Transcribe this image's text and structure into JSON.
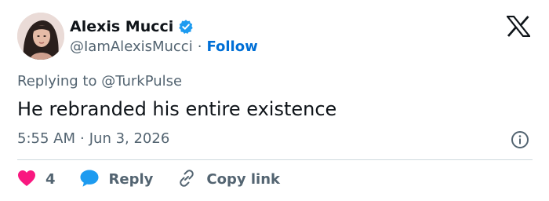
{
  "author": {
    "name": "Alexis Mucci",
    "handle": "@IamAlexisMucci",
    "separator": "·",
    "follow_label": "Follow",
    "verified": true
  },
  "tweet": {
    "replying_to": "Replying to @TurkPulse",
    "text": "He rebranded his entire existence",
    "time": "5:55 AM",
    "time_separator": "·",
    "date": "Jun 3, 2026"
  },
  "actions": {
    "like_count": "4",
    "reply_label": "Reply",
    "copy_link_label": "Copy link"
  },
  "icons": {
    "logo": "x-logo-icon",
    "verified": "verified-badge-icon",
    "info": "info-icon",
    "like": "heart-icon",
    "reply": "speech-bubble-icon",
    "copy": "link-icon"
  },
  "colors": {
    "accent": "#006fd6",
    "verified": "#1d9bf0",
    "like": "#f91880",
    "reply_icon": "#1d9bf0",
    "secondary_text": "#536471",
    "primary_text": "#0f1419",
    "divider": "#cfd9de"
  }
}
